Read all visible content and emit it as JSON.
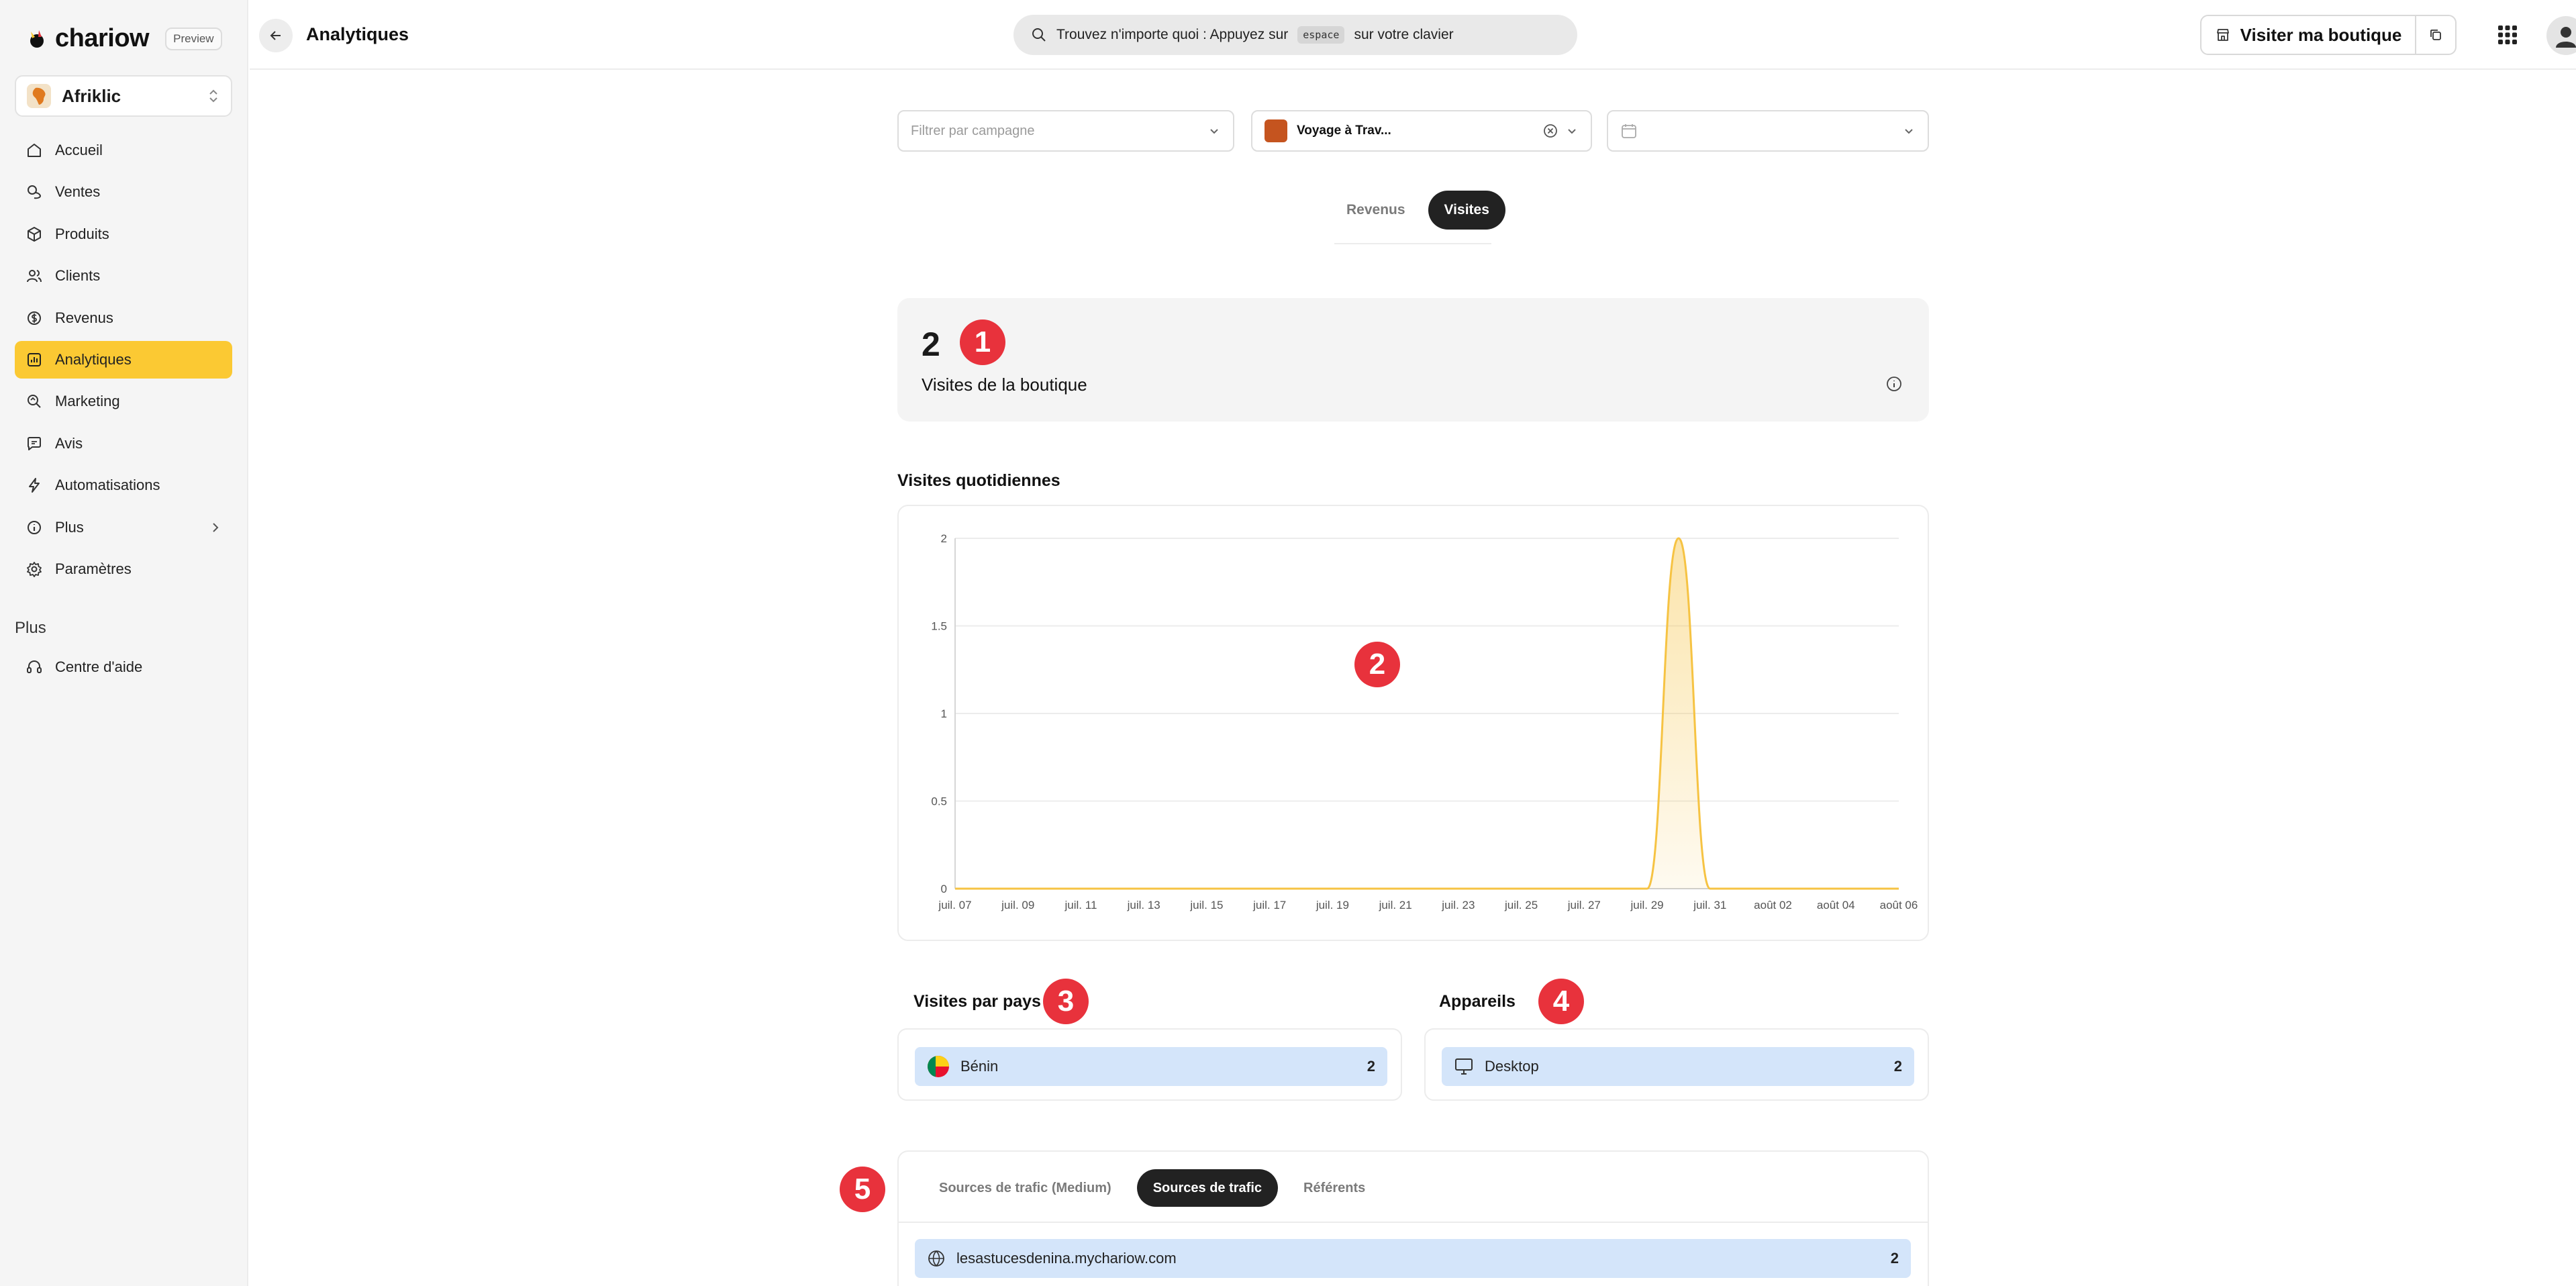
{
  "brand": {
    "name": "chariow",
    "badge": "Preview"
  },
  "store": {
    "name": "Afriklic"
  },
  "nav": [
    {
      "label": "Accueil",
      "icon": "home-icon"
    },
    {
      "label": "Ventes",
      "icon": "coins-icon"
    },
    {
      "label": "Produits",
      "icon": "box-icon"
    },
    {
      "label": "Clients",
      "icon": "users-icon"
    },
    {
      "label": "Revenus",
      "icon": "revenue-icon"
    },
    {
      "label": "Analytiques",
      "icon": "chart-icon",
      "active": true
    },
    {
      "label": "Marketing",
      "icon": "marketing-icon"
    },
    {
      "label": "Avis",
      "icon": "message-icon"
    },
    {
      "label": "Automatisations",
      "icon": "bolt-icon"
    },
    {
      "label": "Plus",
      "icon": "info-icon"
    },
    {
      "label": "Paramètres",
      "icon": "gear-icon"
    }
  ],
  "more_section": {
    "title": "Plus",
    "help": "Centre d'aide"
  },
  "header": {
    "title": "Analytiques",
    "search_prefix": "Trouvez n'importe quoi : Appuyez sur",
    "search_key": "espace",
    "search_suffix": "sur votre clavier",
    "visit_button": "Visiter ma boutique"
  },
  "filters": {
    "campaign_placeholder": "Filtrer par campagne",
    "product_value": "Voyage à Trav...",
    "date_value": ""
  },
  "view_toggle": {
    "options": [
      "Revenus",
      "Visites"
    ],
    "active": "Visites"
  },
  "metric": {
    "value": "2",
    "label": "Visites de la boutique"
  },
  "annotations": [
    "1",
    "2",
    "3",
    "4",
    "5"
  ],
  "daily": {
    "title": "Visites quotidiennes"
  },
  "chart_data": {
    "type": "area",
    "title": "Visites quotidiennes",
    "xlabel": "",
    "ylabel": "",
    "y_ticks": [
      "0",
      "0.5",
      "1",
      "1.5",
      "2"
    ],
    "ylim": [
      0,
      2
    ],
    "x_ticks": [
      "juil. 07",
      "juil. 09",
      "juil. 11",
      "juil. 13",
      "juil. 15",
      "juil. 17",
      "juil. 19",
      "juil. 21",
      "juil. 23",
      "juil. 25",
      "juil. 27",
      "juil. 29",
      "juil. 31",
      "août 02",
      "août 04",
      "août 06"
    ],
    "x_dates": [
      "2024-07-07",
      "2024-07-08",
      "2024-07-09",
      "2024-07-10",
      "2024-07-11",
      "2024-07-12",
      "2024-07-13",
      "2024-07-14",
      "2024-07-15",
      "2024-07-16",
      "2024-07-17",
      "2024-07-18",
      "2024-07-19",
      "2024-07-20",
      "2024-07-21",
      "2024-07-22",
      "2024-07-23",
      "2024-07-24",
      "2024-07-25",
      "2024-07-26",
      "2024-07-27",
      "2024-07-28",
      "2024-07-29",
      "2024-07-30",
      "2024-07-31",
      "2024-08-01",
      "2024-08-02",
      "2024-08-03",
      "2024-08-04",
      "2024-08-05",
      "2024-08-06"
    ],
    "values": [
      0,
      0,
      0,
      0,
      0,
      0,
      0,
      0,
      0,
      0,
      0,
      0,
      0,
      0,
      0,
      0,
      0,
      0,
      0,
      0,
      0,
      0,
      0,
      2,
      0,
      0,
      0,
      0,
      0,
      0,
      0
    ],
    "grid": true,
    "color": "#f6c343"
  },
  "countries": {
    "title": "Visites par pays",
    "items": [
      {
        "label": "Bénin",
        "count": "2"
      }
    ]
  },
  "devices": {
    "title": "Appareils",
    "items": [
      {
        "label": "Desktop",
        "count": "2"
      }
    ]
  },
  "traffic": {
    "tabs": [
      "Sources de trafic (Medium)",
      "Sources de trafic",
      "Référents"
    ],
    "active": "Sources de trafic",
    "items": [
      {
        "label": "lesastucesdenina.mychariow.com",
        "count": "2"
      }
    ]
  },
  "colors": {
    "accent": "#fbc933",
    "badge": "#e8323c",
    "row_bg": "#d4e5fa",
    "dark": "#222222"
  }
}
